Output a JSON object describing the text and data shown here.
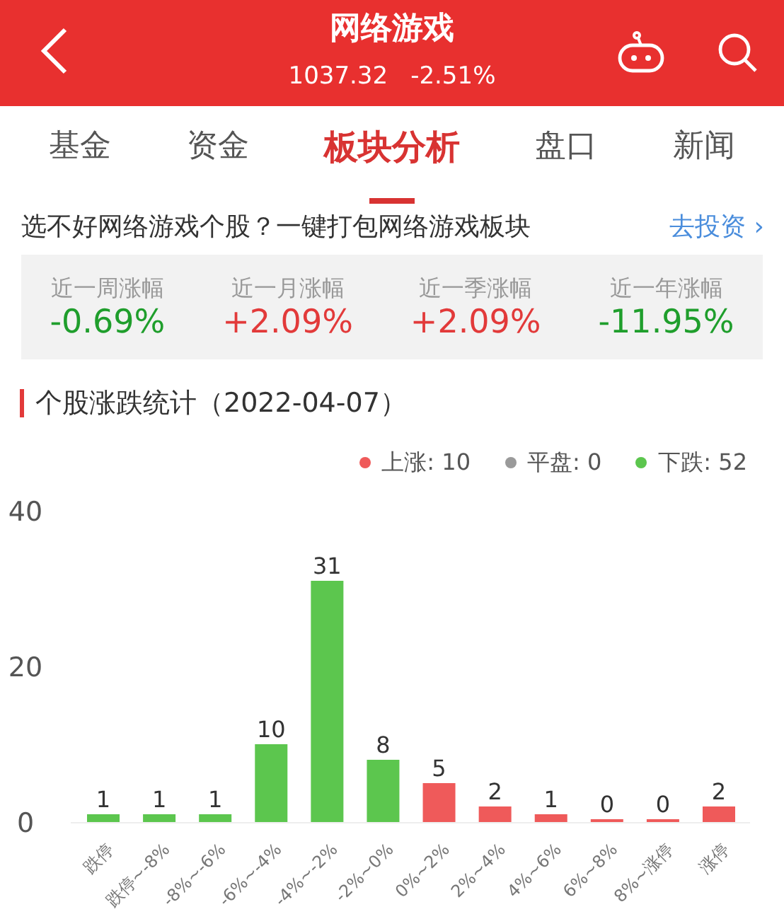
{
  "header": {
    "title": "网络游戏",
    "price": "1037.32",
    "change": "-2.51%"
  },
  "tabs": [
    {
      "label": "基金",
      "selected": false
    },
    {
      "label": "资金",
      "selected": false
    },
    {
      "label": "板块分析",
      "selected": true
    },
    {
      "label": "盘口",
      "selected": false
    },
    {
      "label": "新闻",
      "selected": false
    }
  ],
  "promo": {
    "text": "选不好网络游戏个股？一键打包网络游戏板块",
    "link": "去投资",
    "arrow": "›"
  },
  "stats": [
    {
      "label": "近一周涨幅",
      "value": "-0.69%",
      "color": "#1f9e2c"
    },
    {
      "label": "近一月涨幅",
      "value": "+2.09%",
      "color": "#e23a3a"
    },
    {
      "label": "近一季涨幅",
      "value": "+2.09%",
      "color": "#e23a3a"
    },
    {
      "label": "近一年涨幅",
      "value": "-11.95%",
      "color": "#1f9e2c"
    }
  ],
  "section_title": "个股涨跌统计（2022-04-07）",
  "legend": [
    {
      "label": "上涨: 10",
      "color": "#ef5a5a"
    },
    {
      "label": "平盘: 0",
      "color": "#9a9a9a"
    },
    {
      "label": "下跌: 52",
      "color": "#5cc64e"
    }
  ],
  "chart_data": {
    "type": "bar",
    "categories": [
      "跌停",
      "跌停~-8%",
      "-8%~-6%",
      "-6%~-4%",
      "-4%~-2%",
      "-2%~0%",
      "0%~2%",
      "2%~4%",
      "4%~6%",
      "6%~8%",
      "8%~涨停",
      "涨停"
    ],
    "series": [
      {
        "color": "#5cc64e",
        "values": [
          1,
          1,
          1,
          10,
          31,
          8,
          null,
          null,
          null,
          null,
          null,
          null
        ]
      },
      {
        "color": "#ef5a5a",
        "values": [
          null,
          null,
          null,
          null,
          null,
          null,
          5,
          2,
          1,
          0,
          0,
          2
        ]
      }
    ],
    "ylim": [
      0,
      40
    ],
    "yticks": [
      0,
      20,
      40
    ],
    "data_labels": true
  }
}
